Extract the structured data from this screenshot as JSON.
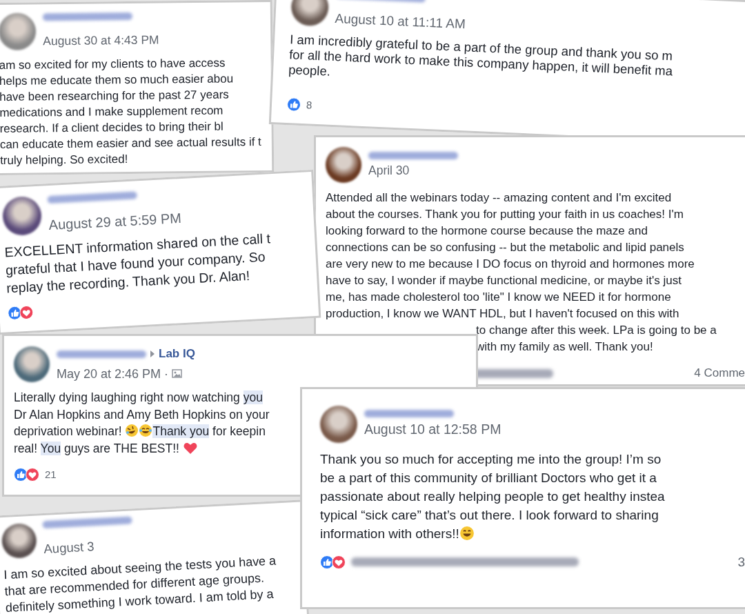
{
  "posts": [
    {
      "time": "August 30 at 4:43 PM",
      "lines": [
        "am so excited for my clients to have access",
        "helps me educate them so much easier abou",
        "have been researching for the past 27 years",
        "medications and I make supplement recom",
        "research. If a client decides to bring their bl",
        "can educate them easier and see actual results if t",
        "truly helping. So excited!"
      ]
    },
    {
      "time": "August 10 at 11:11 AM",
      "lines": [
        "I am incredibly grateful to be a part of the group and thank you so m",
        "for all the hard work to make this company happen, it will benefit ma",
        "people."
      ],
      "reactions": [
        {
          "kind": "like"
        }
      ],
      "reaction_count": "8"
    },
    {
      "time": "August 29 at 5:59 PM",
      "lines": [
        "EXCELLENT information shared on the call t",
        "grateful that I have found your company. So",
        "replay the recording. Thank you Dr. Alan!"
      ],
      "reactions": [
        {
          "kind": "like"
        },
        {
          "kind": "love"
        }
      ]
    },
    {
      "time": "April 30",
      "lines": [
        "Attended all the webinars today -- amazing content and I'm excited",
        "about the courses. Thank you for putting your faith in us coaches! I'm",
        "looking forward to the hormone course because the maze and",
        "connections can be so confusing -- but the metabolic and lipid panels",
        "are very new to me because I DO focus on thyroid and hormones more",
        "have to say, I wonder if maybe functional medicine, or maybe it's just",
        "me, has made cholesterol too 'lite\" I know we NEED it for hormone",
        "production, I know we WANT HDL, but I haven't focused on this with",
        [
          {
            "kind": "covered"
          },
          {
            "kind": "text",
            "text": "to change after this week. LPa is going to be a"
          }
        ],
        [
          {
            "kind": "covered"
          },
          {
            "kind": "text",
            "text": "with my family as well. Thank you!"
          }
        ]
      ],
      "reactors_blurred": true,
      "comments": "4 Comme"
    },
    {
      "time": "May 20 at 2:46 PM",
      "group": "Lab IQ",
      "separator": "·",
      "photo_icon": true,
      "lines": [
        [
          {
            "kind": "text",
            "text": "Literally dying laughing right now watching "
          },
          {
            "kind": "mention",
            "text": "you"
          }
        ],
        "Dr Alan Hopkins and Amy Beth Hopkins on your",
        [
          {
            "kind": "text",
            "text": "deprivation webinar! "
          },
          {
            "kind": "emoji-rofl"
          },
          {
            "kind": "emoji-joy"
          },
          {
            "kind": "mention",
            "text": "Thank you"
          },
          {
            "kind": "text",
            "text": " for keepin"
          }
        ],
        [
          {
            "kind": "text",
            "text": "real! "
          },
          {
            "kind": "mention",
            "text": "You"
          },
          {
            "kind": "text",
            "text": " guys are THE BEST!! "
          },
          {
            "kind": "emoji-heart"
          }
        ]
      ],
      "reactions": [
        {
          "kind": "like"
        },
        {
          "kind": "love"
        }
      ],
      "reaction_count": "21"
    },
    {
      "time": "August 10 at 12:58 PM",
      "lines": [
        "Thank you so much for accepting me into the group! I’m so",
        "be a part of this community of brilliant Doctors who get it a",
        "passionate about really helping people to get healthy instea",
        "typical “sick care” that’s out there. I look forward to sharing",
        [
          {
            "kind": "text",
            "text": "information with others!!"
          },
          {
            "kind": "emoji-smile"
          }
        ]
      ],
      "reactions": [
        {
          "kind": "like"
        },
        {
          "kind": "love"
        }
      ],
      "reactors_blurred": true,
      "comments": "3"
    },
    {
      "time": "August 3",
      "lines": [
        "I am so excited about seeing the tests you have a",
        "that are recommended for different age groups.",
        "definitely something I work toward. I am told by a"
      ]
    }
  ]
}
